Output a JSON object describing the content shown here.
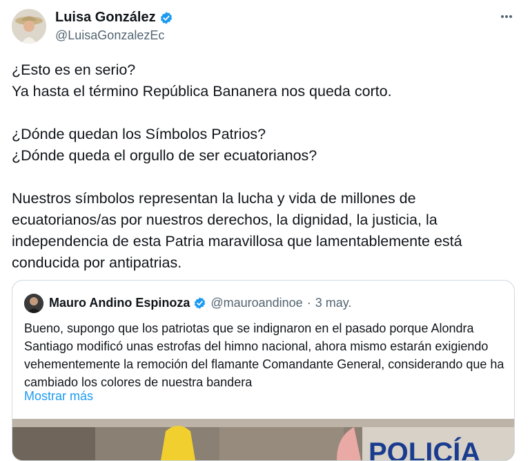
{
  "tweet": {
    "author_name": "Luisa González",
    "handle": "@LuisaGonzalezEc",
    "more_icon": "more-horizontal-icon",
    "verified_icon": "verified-badge-icon",
    "text": "¿Esto es en serio?\nYa hasta el término República Bananera nos queda corto.\n\n¿Dónde quedan los Símbolos Patrios?\n¿Dónde queda el orgullo de ser ecuatorianos?\n\nNuestros símbolos representan la lucha y vida de millones de ecuatorianos/as por nuestros derechos, la dignidad, la justicia, la independencia de esta Patria maravillosa que lamentablemente está conducida por antipatrias."
  },
  "quote": {
    "author_name": "Mauro Andino Espinoza",
    "handle": "@mauroandinoe",
    "separator": "·",
    "date": "3 may.",
    "text": "Bueno, supongo que los patriotas que se indignaron en el pasado porque Alondra Santiago modificó unas estrofas del himno nacional, ahora mismo estarán exigiendo vehementemente la remoción del flamante Comandante General, considerando que ha cambiado los colores de nuestra bandera",
    "show_more": "Mostrar más",
    "media_text": "POLICÍA"
  },
  "colors": {
    "link": "#1d9bf0",
    "secondary_text": "#536471",
    "border": "#cfd9de",
    "verified": "#1d9bf0"
  }
}
